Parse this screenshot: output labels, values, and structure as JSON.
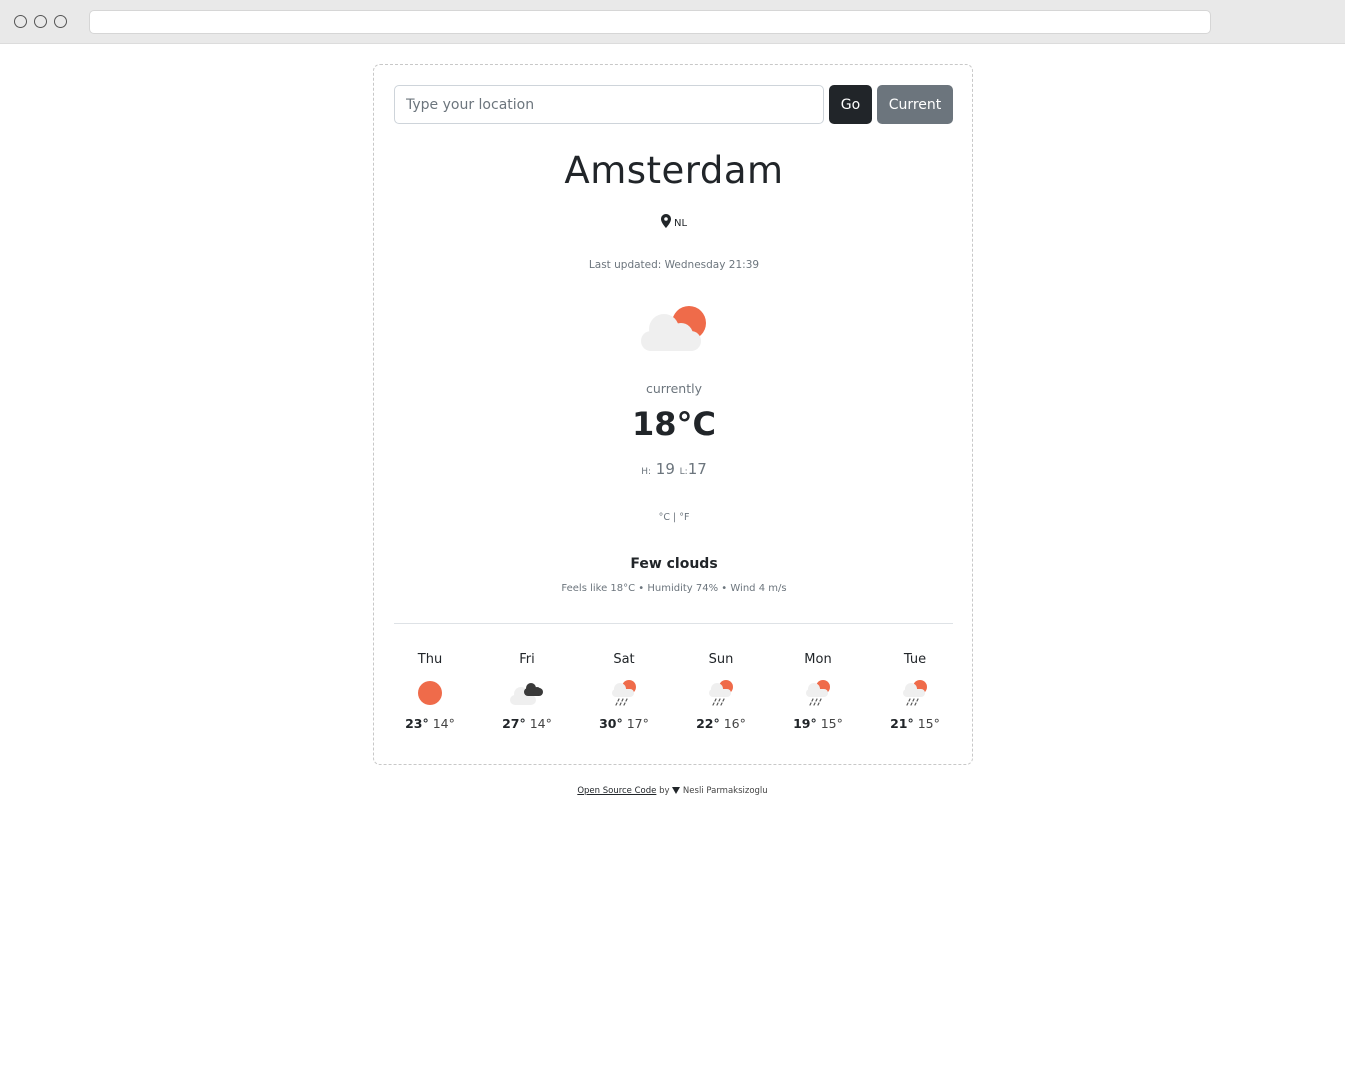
{
  "search": {
    "placeholder": "Type your location",
    "go_label": "Go",
    "current_label": "Current"
  },
  "location": {
    "city": "Amsterdam",
    "country": "NL",
    "last_updated": "Last updated: Wednesday 21:39"
  },
  "current": {
    "icon": "few-clouds-icon",
    "label": "currently",
    "temperature": "18°C",
    "high_label": "H:",
    "high": "19",
    "low_label": "L:",
    "low": "17",
    "unit_c": "°C",
    "unit_separator": "|",
    "unit_f": "°F",
    "description": "Few clouds",
    "details": "Feels like 18°C • Humidity 74% • Wind 4 m/s"
  },
  "forecast": [
    {
      "day": "Thu",
      "icon": "sun-icon",
      "max": "23°",
      "min": "14°"
    },
    {
      "day": "Fri",
      "icon": "broken-clouds-icon",
      "max": "27°",
      "min": "14°"
    },
    {
      "day": "Sat",
      "icon": "rain-icon",
      "max": "30°",
      "min": "17°"
    },
    {
      "day": "Sun",
      "icon": "rain-icon",
      "max": "22°",
      "min": "16°"
    },
    {
      "day": "Mon",
      "icon": "rain-icon",
      "max": "19°",
      "min": "15°"
    },
    {
      "day": "Tue",
      "icon": "rain-icon",
      "max": "21°",
      "min": "15°"
    }
  ],
  "footer": {
    "link_text": "Open Source Code",
    "by_text": "by",
    "author": "Nesli Parmaksizoglu"
  },
  "colors": {
    "accent_sun": "#ef6b4a",
    "cloud": "#efefef",
    "dark_cloud": "#3a3a3a",
    "button_dark": "#212529",
    "button_secondary": "#6c757d"
  }
}
